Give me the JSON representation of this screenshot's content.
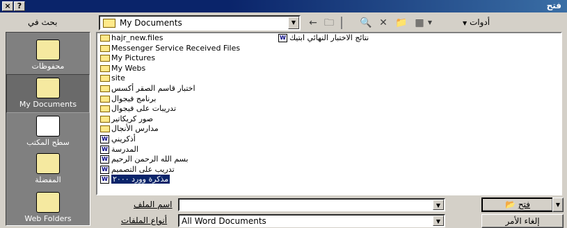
{
  "window": {
    "title": "فتح",
    "help_label": "?",
    "close_label": "×"
  },
  "toolbar": {
    "look_in_label": "بحث في",
    "look_in_value": "My Documents",
    "tools_label": "أدوات"
  },
  "places": [
    {
      "label": "محفوظات",
      "icon": "history-icon"
    },
    {
      "label": "My Documents",
      "icon": "my-documents-icon",
      "selected": true
    },
    {
      "label": "سطح المكتب",
      "icon": "desktop-icon"
    },
    {
      "label": "المفضلة",
      "icon": "favorites-icon"
    },
    {
      "label": "Web Folders",
      "icon": "web-folders-icon"
    }
  ],
  "files_left": [
    {
      "name": "hajr_new.files",
      "type": "folder"
    },
    {
      "name": "Messenger Service Received Files",
      "type": "folder"
    },
    {
      "name": "My Pictures",
      "type": "folder"
    },
    {
      "name": "My Webs",
      "type": "folder"
    },
    {
      "name": "site",
      "type": "folder"
    },
    {
      "name": "اختبار قاسم الصقر أكسس",
      "type": "folder"
    },
    {
      "name": "برنامج فيجوال",
      "type": "folder"
    },
    {
      "name": "تدريبات على فيجوال",
      "type": "folder"
    },
    {
      "name": "صور كريكاتير",
      "type": "folder"
    },
    {
      "name": "مدارس الأنجال",
      "type": "folder"
    },
    {
      "name": "أذكريني",
      "type": "doc"
    },
    {
      "name": "المدرسة",
      "type": "doc"
    },
    {
      "name": "بسم الله الرحمن الرحيم",
      "type": "doc"
    },
    {
      "name": "تدريب على التصميم",
      "type": "doc"
    },
    {
      "name": "مذكرة وورد ٢٠٠٠",
      "type": "doc",
      "selected": true
    }
  ],
  "files_right": [
    {
      "name": "نتائج الاختبار النهائي ابتيك",
      "type": "doc"
    }
  ],
  "bottom": {
    "filename_label": "اسم الملف",
    "filename_value": "",
    "filetype_label": "أنواع الملفات",
    "filetype_value": "All Word Documents",
    "open_label": "فتح",
    "cancel_label": "إلغاء الأمر"
  },
  "colors": {
    "titlebar": "#0a246a",
    "selection": "#0a246a",
    "dialog_bg": "#d4d0c8"
  }
}
